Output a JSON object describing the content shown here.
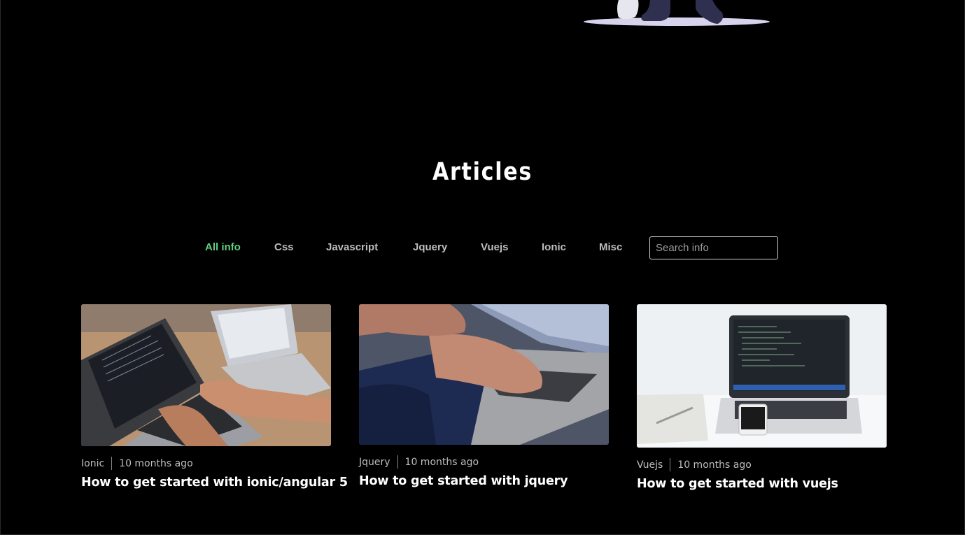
{
  "section": {
    "title": "Articles"
  },
  "filters": [
    {
      "label": "All info",
      "active": true
    },
    {
      "label": "Css",
      "active": false
    },
    {
      "label": "Javascript",
      "active": false
    },
    {
      "label": "Jquery",
      "active": false
    },
    {
      "label": "Vuejs",
      "active": false
    },
    {
      "label": "Ionic",
      "active": false
    },
    {
      "label": "Misc",
      "active": false
    }
  ],
  "search": {
    "placeholder": "Search info",
    "value": ""
  },
  "articles": [
    {
      "category": "Ionic",
      "time": "10 months ago",
      "title": "How to get started with ionic/angular 5"
    },
    {
      "category": "Jquery",
      "time": "10 months ago",
      "title": "How to get started with jquery"
    },
    {
      "category": "Vuejs",
      "time": "10 months ago",
      "title": "How to get started with vuejs"
    }
  ],
  "colors": {
    "background": "#000000",
    "active_filter": "#5fcf80",
    "muted_text": "#bdbdbd"
  }
}
